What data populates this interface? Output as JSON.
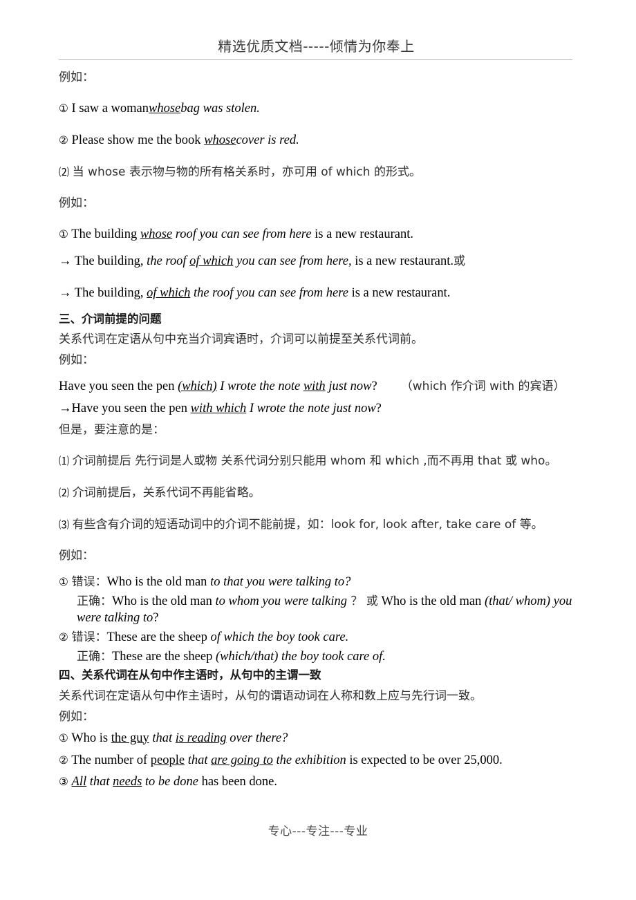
{
  "document": {
    "header": "精选优质文档-----倾情为你奉上",
    "footer": "专心---专注---专业"
  },
  "labels": {
    "eg": "例如：",
    "circle_1": "①",
    "circle_2": "②",
    "circle_3": "③",
    "paren_1": "⑴",
    "paren_2": "⑵",
    "paren_3": "⑶",
    "arrow": "→",
    "or": "或",
    "wrong": "错误：",
    "right": "正确：",
    "colon_cn": "："
  },
  "whose_block": {
    "eg": "例如：",
    "ex1": {
      "num": "①",
      "plain_a": "I saw a woman",
      "itul": "whose",
      "italic_tail": "bag was stolen."
    },
    "ex2": {
      "num": "②",
      "plain_a": "Please show me the book ",
      "itul": "whose",
      "italic_tail": "cover is red."
    },
    "rule2": {
      "num": "⑵",
      "text": "当 whose 表示物与物的所有格关系时，亦可用 of which 的形式。"
    },
    "eg2": "例如：",
    "ex3": {
      "num": "①",
      "plain_a": "The building ",
      "itul": "whose",
      "italic_mid": " roof you can see from here",
      "plain_b": " is a new restaurant."
    },
    "ex3_alt1": {
      "arrow": "→",
      "plain_a": " The building, ",
      "italic_a": "the roof ",
      "itul": "of which",
      "italic_b": " you can see from here,",
      "plain_b": " is a new restaurant.",
      "cn_tail": "或"
    },
    "ex3_alt2": {
      "arrow": "→",
      "plain_a": " The building, ",
      "itul": "of which",
      "italic_a": " the roof you can see from here",
      "plain_b": " is a new restaurant."
    }
  },
  "section_three": {
    "heading": "三、介词前提的问题",
    "intro": "关系代词在定语从句中充当介词宾语时，介词可以前提至关系代词前。",
    "eg": "例如：",
    "pen_sentence": {
      "plain_a": "Have you seen the pen ",
      "itul_a": "(which)",
      "italic_a": " I wrote the note ",
      "itul_b": "with",
      "italic_b": " just now",
      "plain_b": "?",
      "note": "（which 作介词 with 的宾语）"
    },
    "pen_rewrite": {
      "arrow": "→",
      "plain_a": "Have you seen the pen ",
      "itul": "with which",
      "italic_a": " I wrote the note just now",
      "plain_b": "?"
    },
    "but_note": "但是，要注意的是：",
    "rules": [
      {
        "num": "⑴",
        "text": "介词前提后 先行词是人或物 关系代词分别只能用 whom 和 which ,而不再用 that 或 who。"
      },
      {
        "num": "⑵",
        "text": "介词前提后，关系代词不再能省略。"
      },
      {
        "num": "⑶",
        "text": "有些含有介词的短语动词中的介词不能前提，如：look for, look after, take care of 等。"
      }
    ],
    "eg2": "例如：",
    "example_1": {
      "num": "①",
      "wrong_label": "错误：",
      "wrong_plain": "Who is the old man ",
      "wrong_italic": "to that you were talking to?",
      "right_label": "正确：",
      "right_plain_a": "Who is the old man ",
      "right_italic_a": "to whom you were talking",
      "right_q": " ？ ",
      "or": "或",
      "right_plain_b": " Who is the old man ",
      "right_italic_b": "(that/ whom) you were talking to",
      "right_end": "?"
    },
    "example_2": {
      "num": "②",
      "wrong_label": "错误：",
      "wrong_plain": "These are the sheep ",
      "wrong_italic": "of which the boy took care.",
      "right_label": "正确：",
      "right_plain": "These are the sheep ",
      "right_italic": "(which/that) the boy took care of."
    }
  },
  "section_four": {
    "heading": "四、关系代词在从句中作主语时，从句中的主谓一致",
    "intro": "关系代词在定语从句中作主语时，从句的谓语动词在人称和数上应与先行词一致。",
    "eg": "例如：",
    "examples": [
      {
        "num": "①",
        "plain_a": "Who is ",
        "ul_a": "the guy",
        "italic_a": " that ",
        "itul_a": "is reading",
        "italic_b": " over there?"
      },
      {
        "num": "②",
        "plain_a": "The number of ",
        "ul_a": "people",
        "italic_a": " that ",
        "itul_a": "are going to",
        "italic_b": " the exhibition",
        "plain_b": " is expected to be over 25,000."
      },
      {
        "num": "③",
        "itul_a": "All",
        "italic_a": " that ",
        "itul_b": "needs",
        "italic_b": " to be done",
        "plain_b": " has been done."
      }
    ]
  }
}
